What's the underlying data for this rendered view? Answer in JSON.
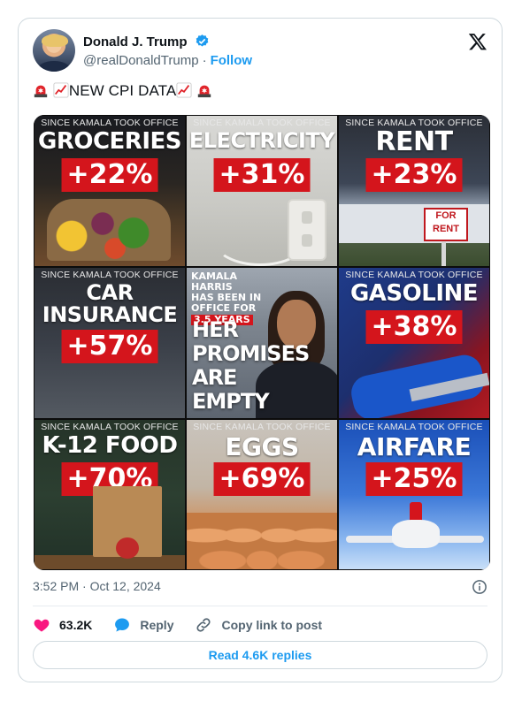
{
  "author": {
    "name": "Donald J. Trump",
    "handle": "@realDonaldTrump",
    "follow_label": "Follow"
  },
  "tweet": {
    "text": "NEW CPI DATA"
  },
  "media": {
    "since_label": "SINCE KAMALA TOOK OFFICE",
    "tiles": [
      {
        "heading": "GROCERIES",
        "percent": "+22%"
      },
      {
        "heading": "ELECTRICITY",
        "percent": "+31%"
      },
      {
        "heading": "RENT",
        "percent": "+23%"
      },
      {
        "heading_line1": "CAR",
        "heading_line2": "INSURANCE",
        "percent": "+57%"
      },
      {
        "line1": "KAMALA HARRIS",
        "line2": "HAS BEEN IN",
        "line3": "OFFICE FOR",
        "years": "3.5 YEARS",
        "big1": "HER",
        "big2": "PROMISES",
        "big3": "ARE",
        "big4": "EMPTY"
      },
      {
        "heading": "GASOLINE",
        "percent": "+38%"
      },
      {
        "heading": "K-12 FOOD",
        "percent": "+70%"
      },
      {
        "heading": "EGGS",
        "percent": "+69%"
      },
      {
        "heading": "AIRFARE",
        "percent": "+25%"
      }
    ],
    "for_rent_sign": "FOR RENT"
  },
  "timestamp": "3:52 PM · Oct 12, 2024",
  "actions": {
    "likes": "63.2K",
    "reply_label": "Reply",
    "copy_label": "Copy link to post"
  },
  "replies_button": "Read 4.6K replies",
  "colors": {
    "accent": "#1d9bf0",
    "like": "#f91880",
    "badge_red": "#d4151c",
    "text_muted": "#536471"
  }
}
